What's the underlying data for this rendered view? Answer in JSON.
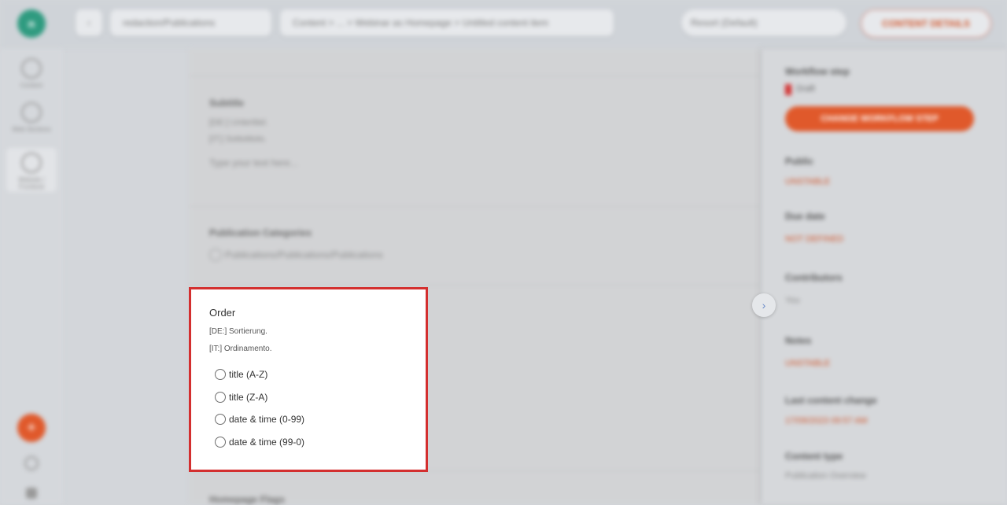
{
  "topbar": {
    "logo_text": "n",
    "back_icon": "chevron-left-icon",
    "workspace": "redaction/Publications",
    "breadcrumb": "Content  >  ...  >  Webinar as Homepage  >  Untitled content item",
    "view_select": "Resort (Default)",
    "details_button": "CONTENT DETAILS"
  },
  "sidebar": {
    "items": [
      {
        "label": "Content",
        "icon": "home-icon"
      },
      {
        "label": "Web Sections",
        "icon": "globe-icon"
      },
      {
        "label": "Website / Frontend",
        "icon": "globe-icon"
      }
    ],
    "fab_icon": "plus-icon"
  },
  "main": {
    "subtitle": {
      "title": "Subtitle",
      "de": "[DE:] Untertitel.",
      "it": "[IT:] Sottotitolo.",
      "placeholder": "Type your text here..."
    },
    "category": {
      "title": "Publication Categories",
      "value": "Publications/Publications/Publications"
    },
    "order": {
      "title": "Order",
      "de": "[DE:] Sortierung.",
      "it": "[IT:] Ordinamento.",
      "options": [
        "title (A-Z)",
        "title (Z-A)",
        "date & time (0-99)",
        "date & time (99-0)"
      ]
    },
    "next_section": "Homepage Flags"
  },
  "rightpanel": {
    "workflow_label": "Workflow step",
    "workflow_value": "Draft",
    "workflow_button": "CHANGE WORKFLOW STEP",
    "fields": [
      {
        "label": "Public",
        "value": "UNSTABLE"
      },
      {
        "label": "Due date",
        "value": "NOT DEFINED"
      },
      {
        "label": "Contributors",
        "value": "You"
      },
      {
        "label": "Notes",
        "value": "UNSTABLE"
      },
      {
        "label": "Last content change",
        "value": "17/09/2023 09:57 AM"
      },
      {
        "label": "Content type",
        "value": "Publication Overview"
      }
    ]
  },
  "colors": {
    "accent": "#d32f2f",
    "brand": "#2f9b80",
    "orange": "#e0592b"
  }
}
